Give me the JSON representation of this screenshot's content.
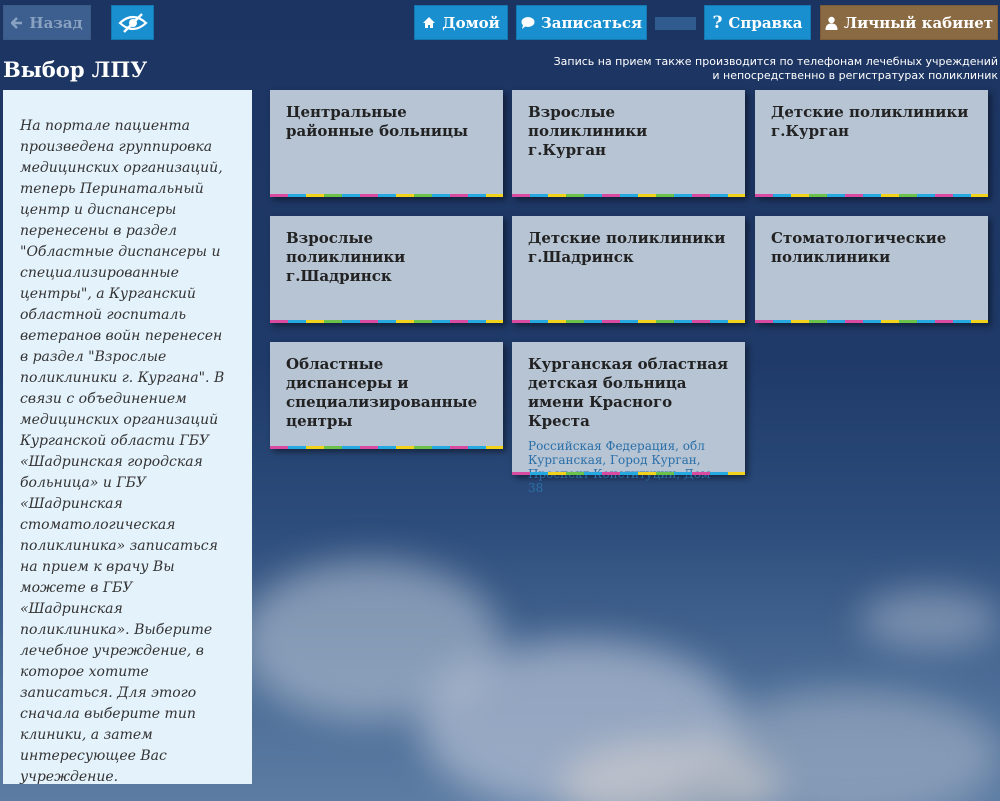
{
  "nav": {
    "back_label": "Назад",
    "home_label": "Домой",
    "signup_label": "Записаться",
    "help_label": "Справка",
    "cabinet_label": "Личный кабинет"
  },
  "icons": {
    "back": "arrow-left-icon",
    "accessibility": "eye-slash-icon",
    "home": "home-icon",
    "signup": "chat-bubble-icon",
    "help": "question-icon",
    "cabinet": "user-icon"
  },
  "page": {
    "title": "Выбор ЛПУ",
    "notice": "Запись на прием также производится по телефонам лечебных учреждений и непосредственно в регистратурах поликлиник"
  },
  "sidebar": {
    "text": "На портале пациента произведена группировка медицинских организаций, теперь Перинатальный центр и диспансеры перенесены в раздел \"Областные диспансеры и специализированные центры\", а Курганский областной госпиталь ветеранов войн перенесен в раздел \"Взрослые поликлиники г. Кургана\". В связи с объединением медицинских организаций Курганской области ГБУ «Шадринская городская больница» и ГБУ «Шадринская стоматологическая поликлиника» записаться на прием к врачу Вы можете в ГБУ «Шадринская поликлиника». Выберите лечебное учреждение, в которое хотите записаться. Для этого сначала выберите тип клиники, а затем интересующее Вас учреждение."
  },
  "tiles": [
    {
      "title": "Центральные районные больницы"
    },
    {
      "title": "Взрослые поликлиники г.Курган"
    },
    {
      "title": "Детские поликлиники г.Курган"
    },
    {
      "title": "Взрослые поликлиники г.Шадринск"
    },
    {
      "title": "Детские поликлиники г.Шадринск"
    },
    {
      "title": "Стоматологические поликлиники"
    },
    {
      "title": "Областные диспансеры и специализированные центры"
    },
    {
      "title": "Курганская областная детская больница имени Красного Креста",
      "address": "Российская Федерация, обл Курганская, Город Курган, Проспект Конституции, Дом 38"
    }
  ],
  "colors": {
    "button_blue": "#1a8fd0",
    "cabinet_brown": "#8a6a43",
    "tile_bg": "#b6c4d4",
    "sidebar_bg": "#e4f2fb"
  }
}
